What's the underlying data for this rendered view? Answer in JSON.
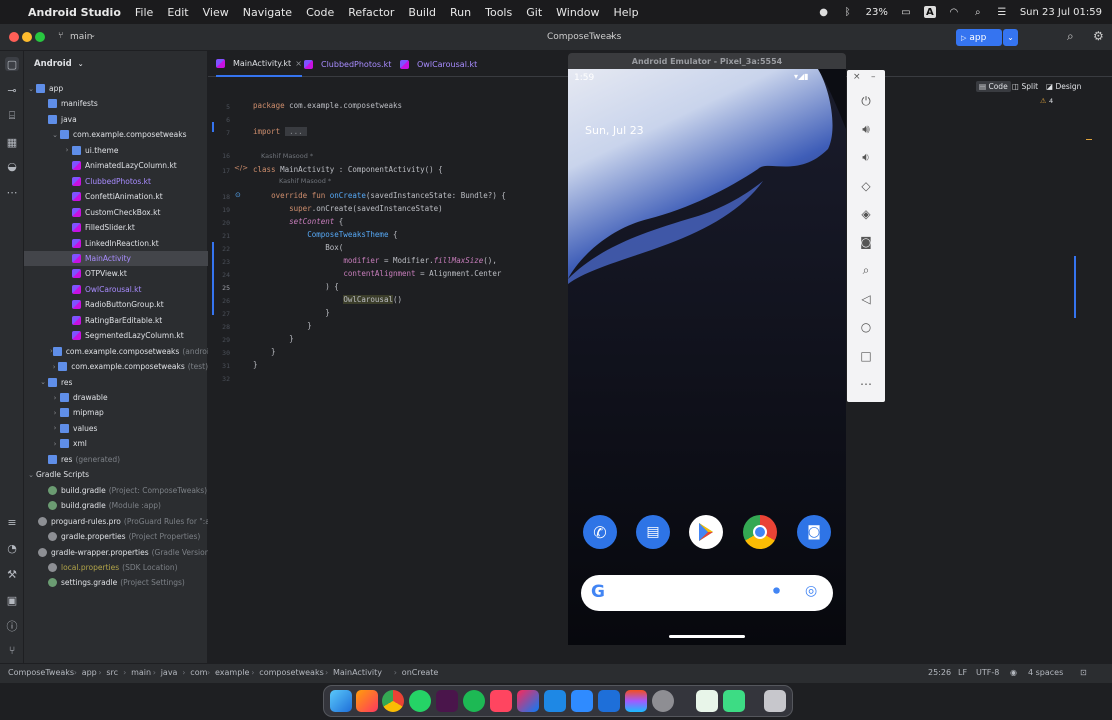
{
  "menubar": {
    "app_name": "Android Studio",
    "menus": [
      "File",
      "Edit",
      "View",
      "Navigate",
      "Code",
      "Refactor",
      "Build",
      "Run",
      "Tools",
      "Git",
      "Window",
      "Help"
    ],
    "battery": "23%",
    "clock": "Sun 23 Jul  01:59"
  },
  "titlebar": {
    "branch": "main",
    "project": "ComposeTweaks",
    "run_config": "app"
  },
  "project_panel": {
    "view_label": "Android",
    "tree": [
      {
        "label": "app",
        "sub": "",
        "kind": "module",
        "depth": 0,
        "arrow": "v"
      },
      {
        "label": "manifests",
        "sub": "",
        "kind": "folder",
        "depth": 1,
        "arrow": ""
      },
      {
        "label": "java",
        "sub": "",
        "kind": "folder",
        "depth": 1,
        "arrow": ""
      },
      {
        "label": "com.example.composetweaks",
        "sub": "",
        "kind": "folder",
        "depth": 2,
        "arrow": "v"
      },
      {
        "label": "ui.theme",
        "sub": "",
        "kind": "folder",
        "depth": 3,
        "arrow": ">"
      },
      {
        "label": "AnimatedLazyColumn.kt",
        "sub": "",
        "kind": "kt",
        "depth": 3,
        "arrow": ""
      },
      {
        "label": "ClubbedPhotos.kt",
        "sub": "",
        "kind": "kt",
        "depth": 3,
        "arrow": "",
        "style": "purple"
      },
      {
        "label": "ConfettiAnimation.kt",
        "sub": "",
        "kind": "kt",
        "depth": 3,
        "arrow": ""
      },
      {
        "label": "CustomCheckBox.kt",
        "sub": "",
        "kind": "kt",
        "depth": 3,
        "arrow": ""
      },
      {
        "label": "FilledSlider.kt",
        "sub": "",
        "kind": "kt",
        "depth": 3,
        "arrow": ""
      },
      {
        "label": "LinkedInReaction.kt",
        "sub": "",
        "kind": "kt",
        "depth": 3,
        "arrow": ""
      },
      {
        "label": "MainActivity",
        "sub": "",
        "kind": "kt",
        "depth": 3,
        "arrow": "",
        "style": "purple",
        "selected": true
      },
      {
        "label": "OTPView.kt",
        "sub": "",
        "kind": "kt",
        "depth": 3,
        "arrow": ""
      },
      {
        "label": "OwlCarousal.kt",
        "sub": "",
        "kind": "kt",
        "depth": 3,
        "arrow": "",
        "style": "purple"
      },
      {
        "label": "RadioButtonGroup.kt",
        "sub": "",
        "kind": "kt",
        "depth": 3,
        "arrow": ""
      },
      {
        "label": "RatingBarEditable.kt",
        "sub": "",
        "kind": "kt",
        "depth": 3,
        "arrow": ""
      },
      {
        "label": "SegmentedLazyColumn.kt",
        "sub": "",
        "kind": "kt",
        "depth": 3,
        "arrow": ""
      },
      {
        "label": "com.example.composetweaks",
        "sub": "(androidTest)",
        "kind": "folder",
        "depth": 2,
        "arrow": ">"
      },
      {
        "label": "com.example.composetweaks",
        "sub": "(test)",
        "kind": "folder",
        "depth": 2,
        "arrow": ">"
      },
      {
        "label": "res",
        "sub": "",
        "kind": "folder",
        "depth": 1,
        "arrow": "v"
      },
      {
        "label": "drawable",
        "sub": "",
        "kind": "folder",
        "depth": 2,
        "arrow": ">"
      },
      {
        "label": "mipmap",
        "sub": "",
        "kind": "folder",
        "depth": 2,
        "arrow": ">"
      },
      {
        "label": "values",
        "sub": "",
        "kind": "folder",
        "depth": 2,
        "arrow": ">"
      },
      {
        "label": "xml",
        "sub": "",
        "kind": "folder",
        "depth": 2,
        "arrow": ">"
      },
      {
        "label": "res",
        "sub": "(generated)",
        "kind": "folder",
        "depth": 1,
        "arrow": ""
      },
      {
        "label": "Gradle Scripts",
        "sub": "",
        "kind": "none",
        "depth": 0,
        "arrow": "v"
      },
      {
        "label": "build.gradle",
        "sub": "(Project: ComposeTweaks)",
        "kind": "gradle",
        "depth": 1,
        "arrow": ""
      },
      {
        "label": "build.gradle",
        "sub": "(Module :app)",
        "kind": "gradle",
        "depth": 1,
        "arrow": ""
      },
      {
        "label": "proguard-rules.pro",
        "sub": "(ProGuard Rules for \":app\")",
        "kind": "prop",
        "depth": 1,
        "arrow": ""
      },
      {
        "label": "gradle.properties",
        "sub": "(Project Properties)",
        "kind": "prop",
        "depth": 1,
        "arrow": ""
      },
      {
        "label": "gradle-wrapper.properties",
        "sub": "(Gradle Version)",
        "kind": "prop",
        "depth": 1,
        "arrow": ""
      },
      {
        "label": "local.properties",
        "sub": "(SDK Location)",
        "kind": "prop",
        "depth": 1,
        "arrow": "",
        "style": "olive"
      },
      {
        "label": "settings.gradle",
        "sub": "(Project Settings)",
        "kind": "gradle",
        "depth": 1,
        "arrow": ""
      }
    ]
  },
  "tabs": [
    {
      "label": "MainActivity.kt",
      "active": true
    },
    {
      "label": "ClubbedPhotos.kt",
      "active": false
    },
    {
      "label": "OwlCarousal.kt",
      "active": false
    }
  ],
  "editor": {
    "mode_code": "Code",
    "mode_split": "Split",
    "mode_design": "Design",
    "warnings": "4",
    "author_hint": "Kashif Masood *",
    "lines": [
      {
        "n": "5",
        "html": "<span class='kw'>package</span> com.example.composetweaks"
      },
      {
        "n": "6",
        "html": ""
      },
      {
        "n": "7",
        "html": "<span class='kw'>import</span> <span style='background:#393b40;color:#8c8f94'> ... </span>"
      },
      {
        "n": "16",
        "html": ""
      },
      {
        "n": "17",
        "html": "<span class='kw'>class</span> MainActivity : ComponentActivity() {"
      },
      {
        "n": "18",
        "html": "    <span class='kw'>override fun</span> <span class='fn'>onCreate</span>(savedInstanceState: Bundle?) {"
      },
      {
        "n": "19",
        "html": "        <span class='kw'>super</span>.onCreate(savedInstanceState)"
      },
      {
        "n": "20",
        "html": "        <span class='it'>setContent</span> {"
      },
      {
        "n": "21",
        "html": "            <span class='gr2' style='color:#56a8f5'>ComposeTweaksTheme</span> {"
      },
      {
        "n": "22",
        "html": "                Box("
      },
      {
        "n": "23",
        "html": "                    <span class='pm'>modifier</span> = Modifier.<span class='it'>fillMaxSize</span>(),"
      },
      {
        "n": "24",
        "html": "                    <span class='pm'>contentAlignment</span> = Alignment.Center"
      },
      {
        "n": "25",
        "html": "                ) {"
      },
      {
        "n": "26",
        "html": "                    <span style='background:#3b3d2a;color:#bcbec4'>OwlCarousal</span>()"
      },
      {
        "n": "27",
        "html": "                }"
      },
      {
        "n": "28",
        "html": "            }"
      },
      {
        "n": "29",
        "html": "        }"
      },
      {
        "n": "30",
        "html": "    }"
      },
      {
        "n": "31",
        "html": "}"
      },
      {
        "n": "32",
        "html": ""
      }
    ]
  },
  "emulator": {
    "title": "Android Emulator - Pixel_3a:5554",
    "time": "1:59",
    "date": "Sun, Jul 23",
    "buttons": [
      "power",
      "volume-up",
      "volume-down",
      "rotate-left",
      "rotate-right",
      "screenshot",
      "zoom",
      "back",
      "home",
      "overview",
      "more"
    ]
  },
  "statusbar": {
    "breadcrumbs": [
      "ComposeTweaks",
      "app",
      "src",
      "main",
      "java",
      "com",
      "example",
      "composetweaks",
      "MainActivity",
      "onCreate"
    ],
    "position": "25:26",
    "line_sep": "LF",
    "encoding": "UTF-8",
    "indent": "4 spaces"
  },
  "colors": {
    "accent": "#3574f0",
    "panel": "#2b2d30",
    "editor_bg": "#1e1f22"
  }
}
